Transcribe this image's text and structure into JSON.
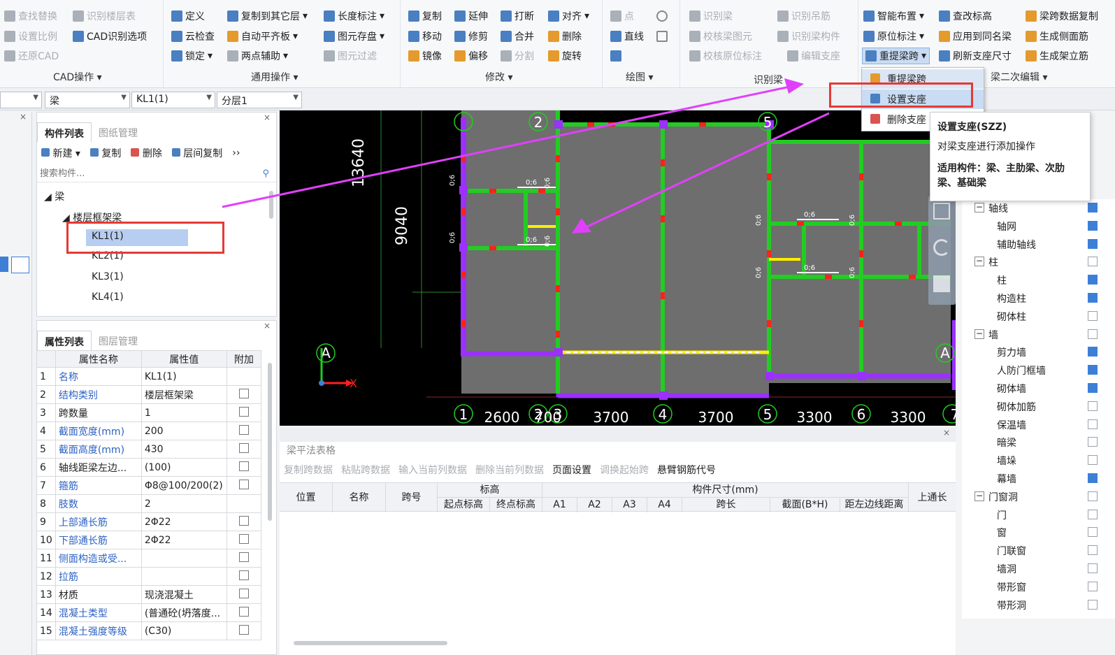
{
  "ribbon": {
    "cad_ops": {
      "items": [
        "查找替换",
        "识别楼层表",
        "设置比例",
        "CAD识别选项",
        "还原CAD"
      ],
      "label": "CAD操作"
    },
    "general_ops": {
      "items": [
        "定义",
        "复制到其它层",
        "长度标注",
        "云检查",
        "自动平齐板",
        "图元存盘",
        "锁定",
        "两点辅助",
        "图元过滤"
      ],
      "label": "通用操作"
    },
    "modify": {
      "items": [
        "复制",
        "延伸",
        "打断",
        "对齐",
        "移动",
        "修剪",
        "合并",
        "删除",
        "镜像",
        "偏移",
        "分割",
        "旋转"
      ],
      "label": "修改"
    },
    "draw": {
      "items": [
        "点",
        "直线"
      ],
      "label": "绘图"
    },
    "identify_beam": {
      "items": [
        "识别梁",
        "识别吊筋",
        "校核梁图元",
        "识别梁构件",
        "校核原位标注",
        "编辑支座"
      ],
      "label": "识别梁"
    },
    "beam_secondary": {
      "items": [
        "智能布置",
        "查改标高",
        "梁跨数据复制",
        "原位标注",
        "应用到同名梁",
        "生成侧面筋",
        "重提梁跨",
        "刷新支座尺寸",
        "生成架立筋"
      ],
      "label": "梁二次编辑"
    }
  },
  "dropdown": {
    "items": [
      "重提梁跨",
      "设置支座",
      "删除支座"
    ]
  },
  "tooltip": {
    "title": "设置支座(SZZ)",
    "desc": "对梁支座进行添加操作",
    "applies": "适用构件：梁、主肋梁、次肋梁、基础梁"
  },
  "selector": {
    "type": "梁",
    "component": "KL1(1)",
    "layer": "分层1"
  },
  "left_panel": {
    "tabs": [
      "构件列表",
      "图纸管理"
    ],
    "toolbar": [
      "新建",
      "复制",
      "删除",
      "层间复制"
    ],
    "search_placeholder": "搜索构件...",
    "tree_root": "梁",
    "tree_group": "楼层框架梁",
    "tree_items": [
      "KL1(1)",
      "KL2(1)",
      "KL3(1)",
      "KL4(1)"
    ]
  },
  "prop_panel": {
    "tabs": [
      "属性列表",
      "图层管理"
    ],
    "headers": [
      "属性名称",
      "属性值",
      "附加"
    ],
    "rows": [
      {
        "n": "1",
        "name": "名称",
        "value": "KL1(1)",
        "blue": true,
        "chk": false
      },
      {
        "n": "2",
        "name": "结构类别",
        "value": "楼层框架梁",
        "blue": true,
        "chk": true
      },
      {
        "n": "3",
        "name": "跨数量",
        "value": "1",
        "blue": false,
        "chk": true
      },
      {
        "n": "4",
        "name": "截面宽度(mm)",
        "value": "200",
        "blue": true,
        "chk": true
      },
      {
        "n": "5",
        "name": "截面高度(mm)",
        "value": "430",
        "blue": true,
        "chk": true
      },
      {
        "n": "6",
        "name": "轴线距梁左边...",
        "value": "(100)",
        "blue": false,
        "chk": true
      },
      {
        "n": "7",
        "name": "箍筋",
        "value": "Φ8@100/200(2)",
        "blue": true,
        "chk": true
      },
      {
        "n": "8",
        "name": "肢数",
        "value": "2",
        "blue": true,
        "chk": false
      },
      {
        "n": "9",
        "name": "上部通长筋",
        "value": "2Φ22",
        "blue": true,
        "chk": true
      },
      {
        "n": "10",
        "name": "下部通长筋",
        "value": "2Φ22",
        "blue": true,
        "chk": true
      },
      {
        "n": "11",
        "name": "侧面构造或受...",
        "value": "",
        "blue": true,
        "chk": true
      },
      {
        "n": "12",
        "name": "拉筋",
        "value": "",
        "blue": true,
        "chk": true
      },
      {
        "n": "13",
        "name": "材质",
        "value": "现浇混凝土",
        "blue": false,
        "chk": true
      },
      {
        "n": "14",
        "name": "混凝土类型",
        "value": "(普通砼(坍落度...",
        "blue": true,
        "chk": true
      },
      {
        "n": "15",
        "name": "混凝土强度等级",
        "value": "(C30)",
        "blue": true,
        "chk": true
      }
    ]
  },
  "cad": {
    "dims_vertical": [
      "13640",
      "9040"
    ],
    "axis_numbers": [
      "1",
      "2",
      "3",
      "4",
      "5",
      "6",
      "7"
    ],
    "axis_letter": "A",
    "dims_bottom": [
      "2600",
      "700",
      "3700",
      "3700",
      "3300",
      "3300"
    ],
    "beam_tag": "0;6",
    "coord_x": "X"
  },
  "beam_table": {
    "title": "梁平法表格",
    "toolbar": [
      "复制跨数据",
      "粘贴跨数据",
      "输入当前列数据",
      "删除当前列数据",
      "页面设置",
      "调换起始跨",
      "悬臂钢筋代号"
    ],
    "headers": [
      "位置",
      "名称",
      "跨号",
      "标高",
      "起点标高",
      "终点标高",
      "构件尺寸(mm)",
      "A1",
      "A2",
      "A3",
      "A4",
      "跨长",
      "截面(B*H)",
      "距左边线距离",
      "上通长"
    ]
  },
  "layers": [
    {
      "label": "轴线",
      "level": 0,
      "on": true
    },
    {
      "label": "轴网",
      "level": 1,
      "on": true
    },
    {
      "label": "辅助轴线",
      "level": 1,
      "on": true
    },
    {
      "label": "柱",
      "level": 0,
      "on": false
    },
    {
      "label": "柱",
      "level": 1,
      "on": true
    },
    {
      "label": "构造柱",
      "level": 1,
      "on": true
    },
    {
      "label": "砌体柱",
      "level": 1,
      "on": false
    },
    {
      "label": "墙",
      "level": 0,
      "on": false
    },
    {
      "label": "剪力墙",
      "level": 1,
      "on": true
    },
    {
      "label": "人防门框墙",
      "level": 1,
      "on": true
    },
    {
      "label": "砌体墙",
      "level": 1,
      "on": true
    },
    {
      "label": "砌体加筋",
      "level": 1,
      "on": false
    },
    {
      "label": "保温墙",
      "level": 1,
      "on": false
    },
    {
      "label": "暗梁",
      "level": 1,
      "on": false
    },
    {
      "label": "墙垛",
      "level": 1,
      "on": false
    },
    {
      "label": "幕墙",
      "level": 1,
      "on": true
    },
    {
      "label": "门窗洞",
      "level": 0,
      "on": false
    },
    {
      "label": "门",
      "level": 1,
      "on": false
    },
    {
      "label": "窗",
      "level": 1,
      "on": false
    },
    {
      "label": "门联窗",
      "level": 1,
      "on": false
    },
    {
      "label": "墙洞",
      "level": 1,
      "on": false
    },
    {
      "label": "带形窗",
      "level": 1,
      "on": false
    },
    {
      "label": "带形洞",
      "level": 1,
      "on": false
    }
  ],
  "colors": {
    "highlight_box": "#e53935",
    "arrow": "#e040fb",
    "beam_green": "#22cc22",
    "column_purple": "#9b30ff",
    "cad_bg": "#000000"
  }
}
